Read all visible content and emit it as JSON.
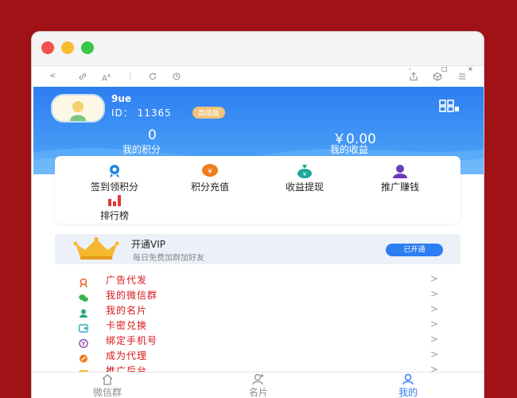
{
  "browser": {
    "back_symbol": "<",
    "tab_controls": [
      "-",
      "□",
      "×"
    ]
  },
  "profile": {
    "name": "9ue",
    "id_text": "ID： 11365",
    "level_badge": "高级版"
  },
  "stats": [
    {
      "value": "0",
      "label": "我的积分"
    },
    {
      "value": "￥0.00",
      "label": "我的收益"
    }
  ],
  "actions": [
    {
      "label": "签到领积分",
      "icon": "badge-icon",
      "color": "#1e88e5"
    },
    {
      "label": "积分充值",
      "icon": "yen-coin-icon",
      "color": "#f07c1e"
    },
    {
      "label": "收益提现",
      "icon": "money-bag-icon",
      "color": "#1aa99a"
    },
    {
      "label": "推广赚钱",
      "icon": "user-icon",
      "color": "#6a3db8"
    },
    {
      "label": "排行榜",
      "icon": "bar-chart-icon",
      "color": "#e53935"
    }
  ],
  "vip": {
    "title": "开通VIP",
    "subtitle": "每日免费加群加好友",
    "button": "已开通"
  },
  "menu": [
    {
      "label": "广告代发",
      "icon": "ribbon-icon",
      "color": "#f0602c"
    },
    {
      "label": "我的微信群",
      "icon": "wechat-icon",
      "color": "#39b54a"
    },
    {
      "label": "我的名片",
      "icon": "contact-icon",
      "color": "#2aa57c"
    },
    {
      "label": "卡密兑换",
      "icon": "card-icon",
      "color": "#35a9c5"
    },
    {
      "label": "绑定手机号",
      "icon": "phone-icon",
      "color": "#8e44ad"
    },
    {
      "label": "成为代理",
      "icon": "agent-icon",
      "color": "#f07c1e"
    },
    {
      "label": "推广后台",
      "icon": "dashboard-icon",
      "color": "#f5b82e"
    }
  ],
  "menu_arrow": ">",
  "tabs": [
    {
      "label": "微信群",
      "icon": "home-icon",
      "active": false
    },
    {
      "label": "名片",
      "icon": "add-user-icon",
      "active": false
    },
    {
      "label": "我的",
      "icon": "profile-icon",
      "active": true
    }
  ],
  "colors": {
    "primary": "#2d7ef2",
    "frame": "#a11216",
    "menu_text": "#d9161c"
  }
}
